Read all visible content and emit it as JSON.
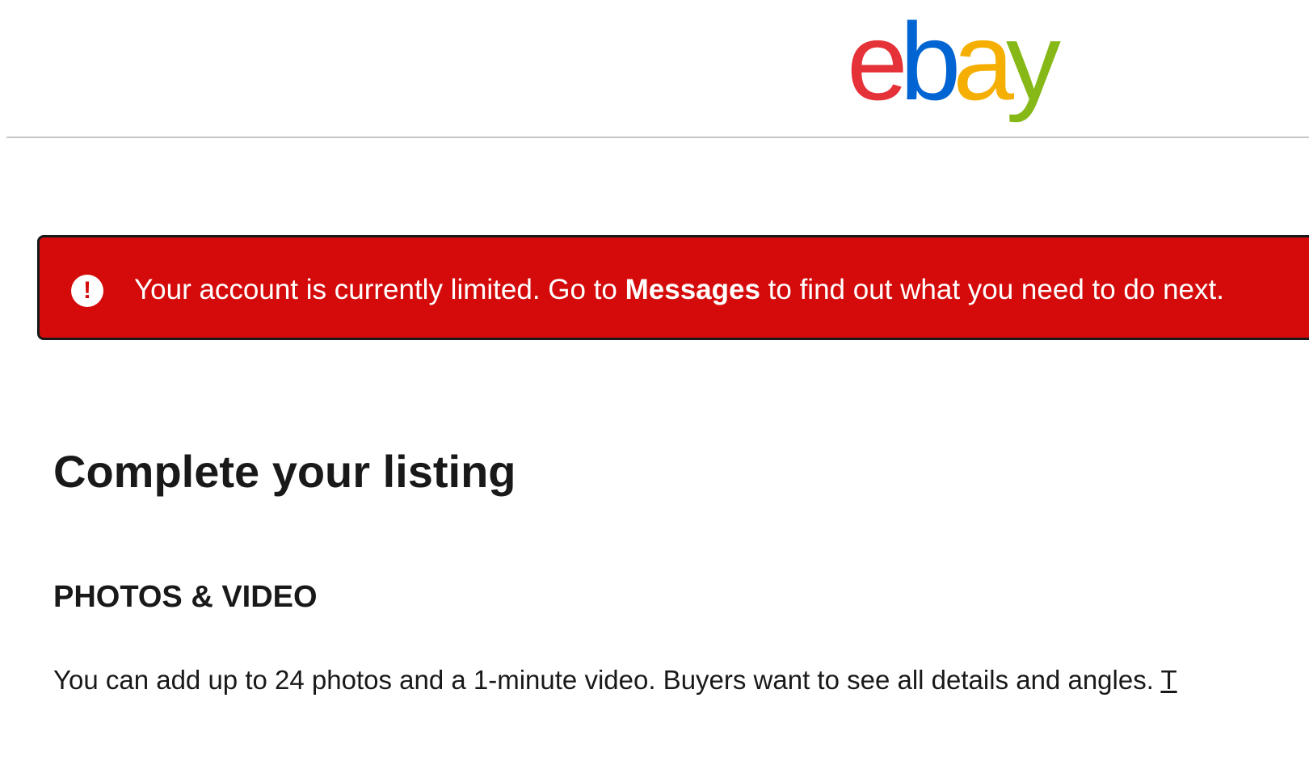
{
  "header": {
    "logo": {
      "letters": [
        "e",
        "b",
        "a",
        "y"
      ],
      "colors": [
        "#e53238",
        "#0064d2",
        "#f5af02",
        "#86b817"
      ]
    }
  },
  "alert": {
    "icon": "alert-circle-icon",
    "text_before": "Your account is currently limited. Go to ",
    "link_label": "Messages",
    "text_after": " to find out what you need to do next.",
    "background_color": "#d50b0b"
  },
  "main": {
    "title": "Complete your listing",
    "photos_section": {
      "heading": "PHOTOS & VIDEO",
      "description": "You can add up to 24 photos and a 1-minute video. Buyers want to see all details and angles. ",
      "link_partial": "T"
    }
  }
}
